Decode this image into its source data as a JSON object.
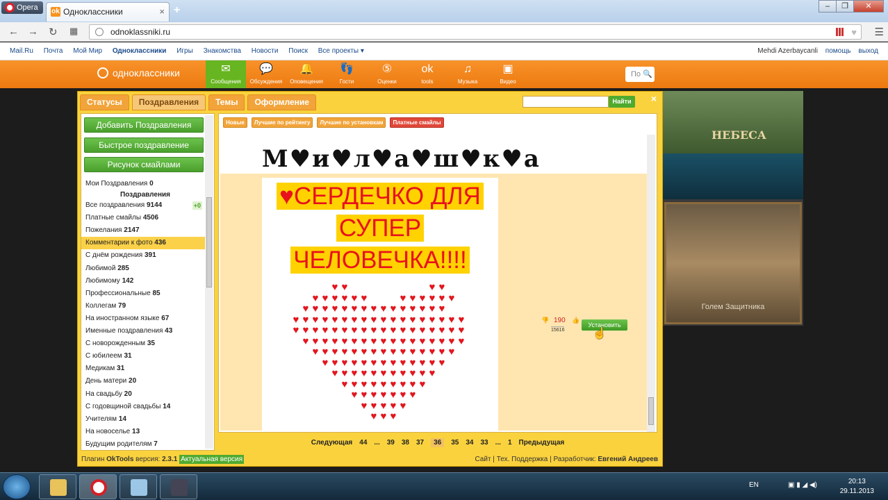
{
  "browser": {
    "menu_label": "Opera",
    "tab_title": "Одноклассники",
    "url": "odnoklassniki.ru"
  },
  "mailbar": {
    "links": [
      "Mail.Ru",
      "Почта",
      "Мой Мир",
      "Одноклассники",
      "Игры",
      "Знакомства",
      "Новости",
      "Поиск",
      "Все проекты ▾"
    ],
    "user": "Mehdi Azerbaycanli",
    "help": "помощь",
    "logout": "выход"
  },
  "ok_header": {
    "logo": "одноклассники",
    "nav": [
      {
        "label": "Сообщения",
        "icon": "envelope-icon",
        "glyph": "✉",
        "active": true
      },
      {
        "label": "Обсуждения",
        "icon": "chat-icon",
        "glyph": "💬",
        "active": false
      },
      {
        "label": "Оповещения",
        "icon": "bell-icon",
        "glyph": "🔔",
        "active": false
      },
      {
        "label": "Гости",
        "icon": "footprints-icon",
        "glyph": "👣",
        "active": false
      },
      {
        "label": "Оценки",
        "icon": "rating-icon",
        "glyph": "⑤",
        "active": false
      },
      {
        "label": "tools",
        "icon": "ok-tools-icon",
        "glyph": "ok",
        "active": false
      },
      {
        "label": "Музыка",
        "icon": "music-icon",
        "glyph": "♫",
        "active": false
      },
      {
        "label": "Видео",
        "icon": "video-icon",
        "glyph": "▣",
        "active": false
      }
    ],
    "search_placeholder": "По"
  },
  "ad": {
    "logo": "НЕБЕСА",
    "caption": "Голем Защитника"
  },
  "plugin": {
    "tabs": [
      {
        "label": "Статусы",
        "active": false
      },
      {
        "label": "Поздравления",
        "active": true
      },
      {
        "label": "Темы",
        "active": false
      },
      {
        "label": "Оформление",
        "active": false
      }
    ],
    "find_label": "Найти",
    "close": "×",
    "buttons": [
      "Добавить Поздравления",
      "Быстрое поздравление",
      "Рисунок смайлами"
    ],
    "categories": [
      {
        "label": "Мои Поздравления",
        "count": "0"
      },
      {
        "label": "Поздравления",
        "count": "",
        "sub": true
      },
      {
        "label": "Все поздравления",
        "count": "9144",
        "plus": "+0"
      },
      {
        "label": "Платные смайлы",
        "count": "4506"
      },
      {
        "label": "Пожелания",
        "count": "2147"
      },
      {
        "label": "Комментарии к фото",
        "count": "436",
        "selected": true
      },
      {
        "label": "С днём рождения",
        "count": "391"
      },
      {
        "label": "Любимой",
        "count": "285"
      },
      {
        "label": "Любимому",
        "count": "142"
      },
      {
        "label": "Профессиональные",
        "count": "85"
      },
      {
        "label": "Коллегам",
        "count": "79"
      },
      {
        "label": "На иностранном языке",
        "count": "67"
      },
      {
        "label": "Именные поздравления",
        "count": "43"
      },
      {
        "label": "С новорожденным",
        "count": "35"
      },
      {
        "label": "С юбилеем",
        "count": "31"
      },
      {
        "label": "Медикам",
        "count": "31"
      },
      {
        "label": "День матери",
        "count": "20"
      },
      {
        "label": "На свадьбу",
        "count": "20"
      },
      {
        "label": "С годовщиной свадьбы",
        "count": "14"
      },
      {
        "label": "Учителям",
        "count": "14"
      },
      {
        "label": "На новоселье",
        "count": "13"
      },
      {
        "label": "Будущим родителям",
        "count": "7"
      }
    ],
    "filters": [
      {
        "label": "Новые",
        "style": "o"
      },
      {
        "label": "Лучшие по рейтингу",
        "style": "o"
      },
      {
        "label": "Лучшие по установкам",
        "style": "o"
      },
      {
        "label": "Платные смайлы",
        "style": "r"
      }
    ],
    "card": {
      "caption": "М♥и♥л♥а♥ш♥к♥а",
      "lines": [
        "♥СЕРДЕЧКО ДЛЯ",
        "СУПЕР",
        "ЧЕЛОВЕЧКА!!!!"
      ],
      "votes": "190",
      "total": "15616",
      "install_label": "Установить"
    },
    "pager": {
      "next": "Следующая",
      "pages": [
        "44",
        "...",
        "39",
        "38",
        "37",
        "36",
        "35",
        "34",
        "33",
        "...",
        "1"
      ],
      "current": "36",
      "prev": "Предыдущая"
    },
    "footer": {
      "plugin_label": "Плагин",
      "plugin_name": "OkTools",
      "version_label": "версия:",
      "version": "2.3.1",
      "status": "Актуальная версия",
      "site": "Сайт",
      "support": "Тех. Поддержка",
      "dev_label": "Разработчик:",
      "dev": "Евгений Андреев"
    }
  },
  "taskbar": {
    "lang": "EN",
    "time": "20:13",
    "date": "29.11.2013"
  }
}
